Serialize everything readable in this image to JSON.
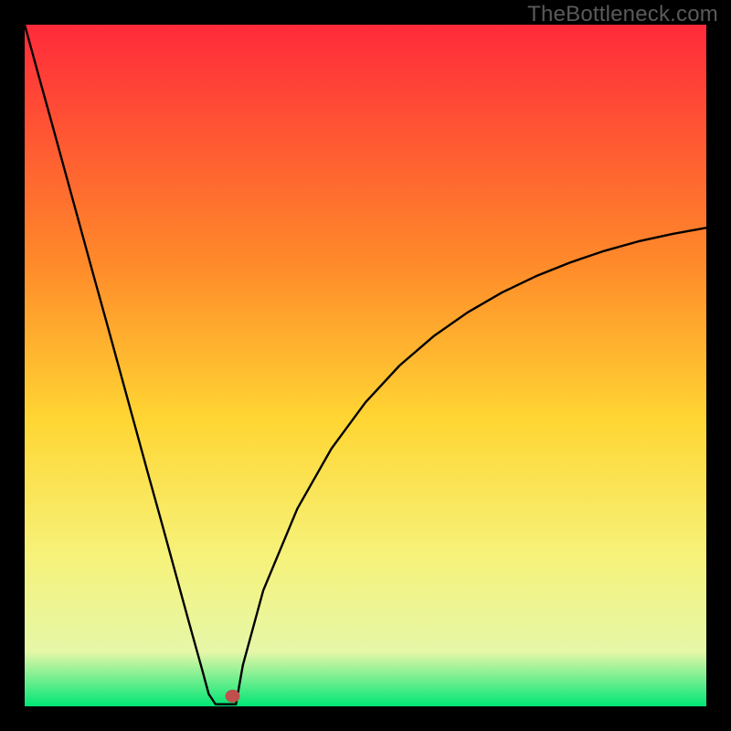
{
  "attribution": "TheBottleneck.com",
  "chart_data": {
    "type": "line",
    "title": "",
    "xlabel": "",
    "ylabel": "",
    "xlim": [
      0,
      100
    ],
    "ylim": [
      0,
      100
    ],
    "background_gradient": {
      "top": "#ff2a3b",
      "upper_mid": "#ff8a2a",
      "mid": "#ffd633",
      "lower_mid": "#f6f27a",
      "low": "#e6f7a8",
      "bottom": "#00e676"
    },
    "x": [
      0,
      2,
      4,
      6,
      8,
      10,
      12,
      14,
      16,
      18,
      20,
      22,
      24,
      26,
      27,
      28,
      29,
      30,
      31,
      32,
      35,
      40,
      45,
      50,
      55,
      60,
      65,
      70,
      75,
      80,
      85,
      90,
      95,
      100
    ],
    "values": [
      100,
      92.7,
      85.5,
      78.2,
      70.9,
      63.6,
      56.4,
      49.1,
      41.8,
      34.5,
      27.3,
      20.0,
      12.7,
      5.5,
      1.8,
      0.3,
      0.3,
      0.3,
      0.3,
      6.0,
      17.0,
      29.0,
      37.8,
      44.6,
      50.0,
      54.3,
      57.8,
      60.7,
      63.1,
      65.1,
      66.8,
      68.2,
      69.3,
      70.2
    ],
    "marker": {
      "x": 30.5,
      "y": 1.5,
      "color": "#c0504d"
    },
    "grid": false,
    "legend": false
  }
}
